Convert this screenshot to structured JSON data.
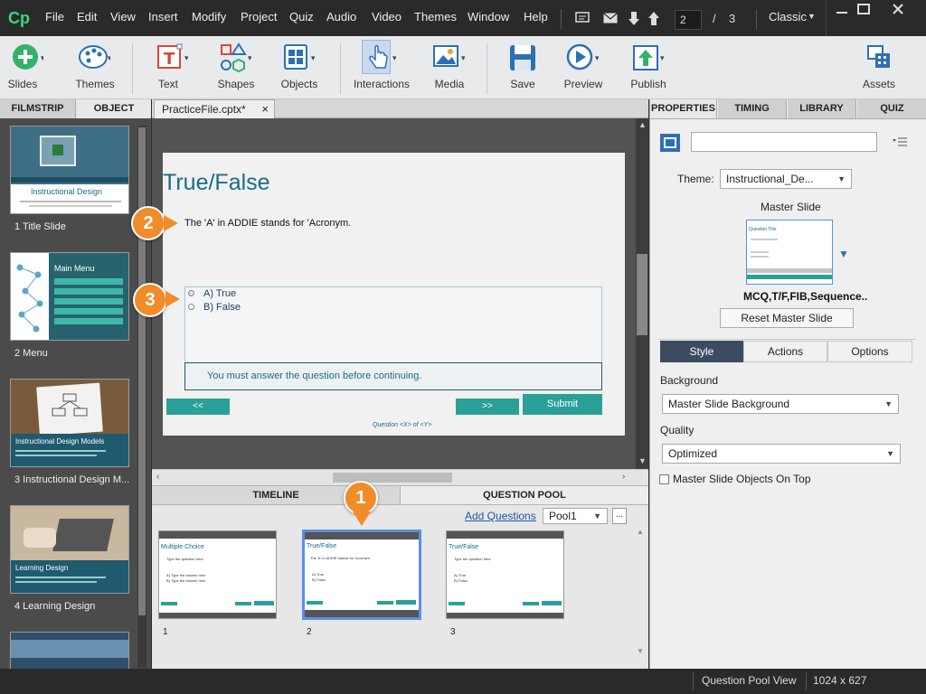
{
  "menubar": {
    "logo": "Cp",
    "items": [
      "File",
      "Edit",
      "View",
      "Insert",
      "Modify",
      "Project",
      "Quiz",
      "Audio",
      "Video",
      "Themes",
      "Window",
      "Help"
    ],
    "page_current": "2",
    "page_separator": "/",
    "page_total": "3",
    "workspace": "Classic"
  },
  "toolbar": {
    "slides": "Slides",
    "themes": "Themes",
    "text": "Text",
    "shapes": "Shapes",
    "objects": "Objects",
    "interactions": "Interactions",
    "media": "Media",
    "save": "Save",
    "preview": "Preview",
    "publish": "Publish",
    "assets": "Assets"
  },
  "left_panel": {
    "tabs": [
      "FILMSTRIP",
      "OBJECT STATE"
    ],
    "slides": [
      {
        "label": "1 Title Slide",
        "title": "Instructional Design"
      },
      {
        "label": "2 Menu",
        "title": "Main Menu"
      },
      {
        "label": "3 Instructional Design M...",
        "title": "Instructional Design Models"
      },
      {
        "label": "4 Learning Design",
        "title": "Learning Design"
      }
    ]
  },
  "doc_tab": {
    "name": "PracticeFile.cptx*",
    "close": "×"
  },
  "slide": {
    "title": "True/False",
    "question": "The 'A' in ADDIE stands for 'Acronym.",
    "answers": [
      "A) True",
      "B) False"
    ],
    "feedback": "You must answer the question before continuing.",
    "back_btn": "<<",
    "next_btn": ">>",
    "submit_btn": "Submit",
    "progress": "Question <X> of <Y>"
  },
  "bottom_panel": {
    "tabs": [
      "TIMELINE",
      "QUESTION POOL"
    ],
    "add_questions": "Add Questions",
    "pool": "Pool1",
    "more": "...",
    "questions": [
      {
        "num": "1",
        "title": "Multiple Choice",
        "q": "Type the question here",
        "a1": "A) Type the answer here",
        "a2": "B) Type the answer here"
      },
      {
        "num": "2",
        "title": "True/False",
        "q": "The 'A' in ADDIE stands for 'Acronym.",
        "a1": "A) True",
        "a2": "B) False"
      },
      {
        "num": "3",
        "title": "True/False",
        "q": "Type the question here",
        "a1": "A) True",
        "a2": "B) False"
      }
    ]
  },
  "right_panel": {
    "tabs": [
      "PROPERTIES",
      "TIMING",
      "LIBRARY",
      "QUIZ"
    ],
    "theme_label": "Theme:",
    "theme_value": "Instructional_De...",
    "master_slide_label": "Master Slide",
    "master_thumb_title": "Question Title",
    "master_slide_name": "MCQ,T/F,FIB,Sequence..",
    "reset_button": "Reset Master Slide",
    "subtabs": [
      "Style",
      "Actions",
      "Options"
    ],
    "background_label": "Background",
    "background_value": "Master Slide Background",
    "quality_label": "Quality",
    "quality_value": "Optimized",
    "master_objects_label": "Master Slide Objects On Top"
  },
  "statusbar": {
    "view": "Question Pool View",
    "size": "1024 x 627"
  },
  "callouts": [
    "1",
    "2",
    "3"
  ],
  "colors": {
    "accent_teal": "#2aa198",
    "title_teal": "#1a6b8a",
    "callout_orange": "#f08d2a",
    "selected_blue": "#5b8ee6"
  }
}
